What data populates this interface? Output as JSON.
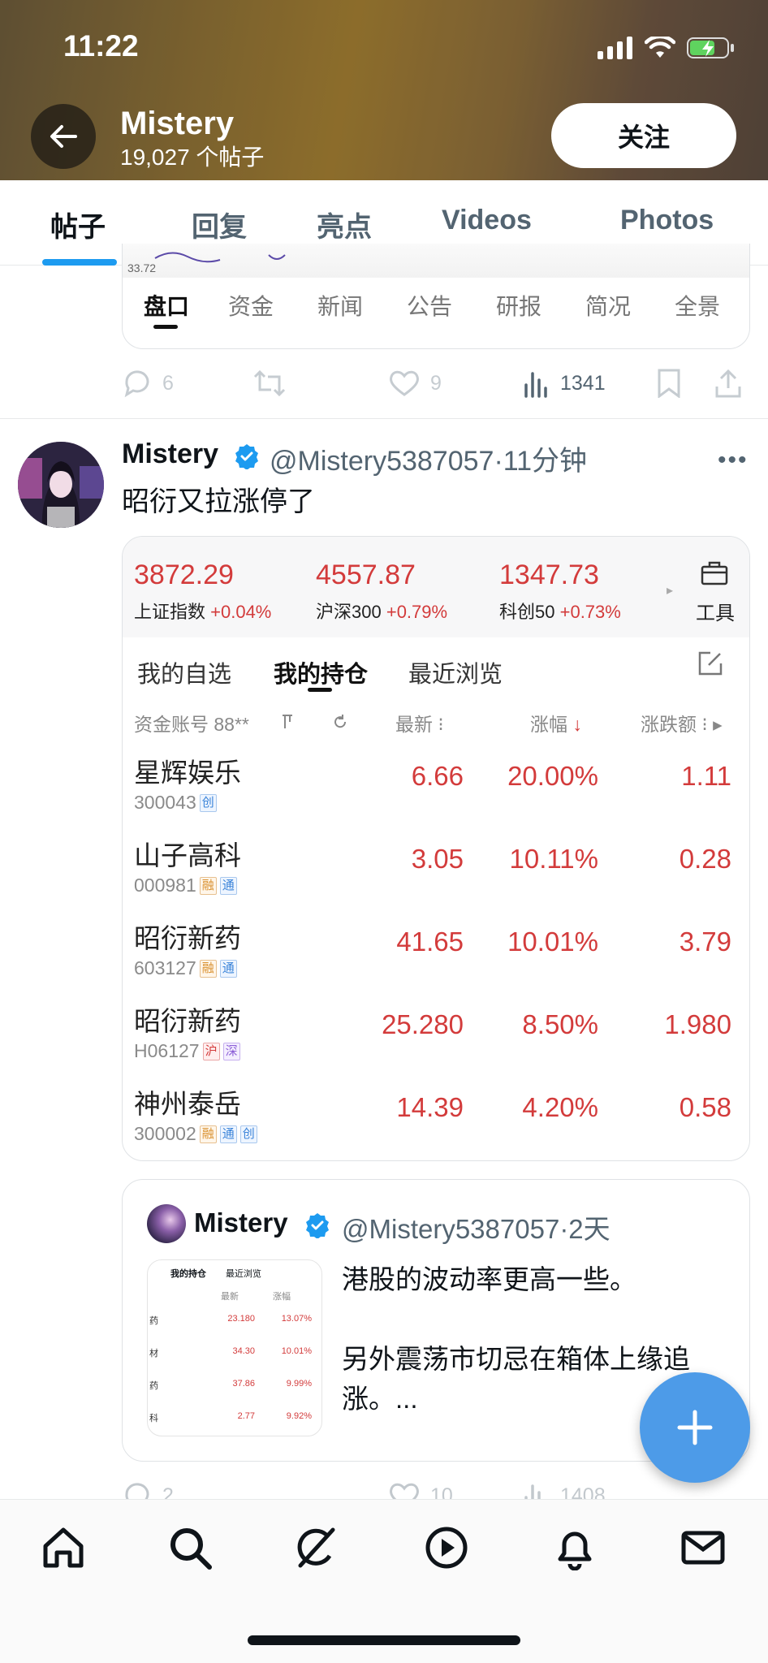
{
  "status_bar": {
    "time": "11:22"
  },
  "header": {
    "name": "Mistery",
    "post_count": "19,027 个帖子",
    "follow_label": "关注"
  },
  "tabs": [
    {
      "label": "帖子",
      "active": true
    },
    {
      "label": "回复"
    },
    {
      "label": "亮点"
    },
    {
      "label": "Videos"
    },
    {
      "label": "Photos"
    }
  ],
  "prev_post": {
    "chart_fragment": "33.72",
    "tabs": [
      "盘口",
      "资金",
      "新闻",
      "公告",
      "研报",
      "简况",
      "全景"
    ],
    "actions": {
      "replies": "6",
      "likes": "9",
      "views": "1341"
    }
  },
  "tweet": {
    "name": "Mistery",
    "handle": "@Mistery5387057",
    "time": "·11分钟",
    "text": "昭衍又拉涨停了",
    "indices": [
      {
        "value": "3872.29",
        "name": "上证指数",
        "change": "+0.04%"
      },
      {
        "value": "4557.87",
        "name": "沪深300",
        "change": "+0.79%"
      },
      {
        "value": "1347.73",
        "name": "科创50",
        "change": "+0.73%"
      }
    ],
    "tools_label": "工具",
    "subtabs": [
      "我的自选",
      "我的持仓",
      "最近浏览"
    ],
    "columns": {
      "account": "资金账号 88**",
      "latest": "最新",
      "pct": "涨幅",
      "chg": "涨跌额"
    },
    "rows": [
      {
        "name": "星辉娱乐",
        "code": "300043",
        "tags": [
          "创"
        ],
        "latest": "6.66",
        "pct": "20.00%",
        "chg": "1.11"
      },
      {
        "name": "山子高科",
        "code": "000981",
        "tags": [
          "融",
          "通"
        ],
        "latest": "3.05",
        "pct": "10.11%",
        "chg": "0.28"
      },
      {
        "name": "昭衍新药",
        "code": "603127",
        "tags": [
          "融",
          "通"
        ],
        "latest": "41.65",
        "pct": "10.01%",
        "chg": "3.79"
      },
      {
        "name": "昭衍新药",
        "code": "H06127",
        "tags": [
          "沪",
          "深"
        ],
        "latest": "25.280",
        "pct": "8.50%",
        "chg": "1.980"
      },
      {
        "name": "神州泰岳",
        "code": "300002",
        "tags": [
          "融",
          "通",
          "创"
        ],
        "latest": "14.39",
        "pct": "4.20%",
        "chg": "0.58"
      }
    ]
  },
  "quote": {
    "name": "Mistery",
    "handle": "@Mistery5387057",
    "time": "·2天",
    "text": "港股的波动率更高一些。\n\n另外震荡市切忌在箱体上缘追涨。...",
    "thumb": {
      "tabs": [
        "我的持仓",
        "最近浏览"
      ],
      "headers": [
        "最新",
        "涨幅"
      ],
      "rows": [
        {
          "name": "药",
          "latest": "23.180",
          "pct": "13.07%"
        },
        {
          "name": "材",
          "latest": "34.30",
          "pct": "10.01%"
        },
        {
          "name": "药",
          "latest": "37.86",
          "pct": "9.99%"
        },
        {
          "name": "科",
          "latest": "2.77",
          "pct": "9.92%"
        }
      ]
    }
  },
  "next_actions": {
    "replies": "2",
    "likes": "10",
    "views": "1408"
  },
  "fab": {
    "icon": "plus-icon"
  },
  "bottom_nav": [
    "home-icon",
    "search-icon",
    "grok-icon",
    "video-icon",
    "notifications-icon",
    "messages-icon"
  ]
}
